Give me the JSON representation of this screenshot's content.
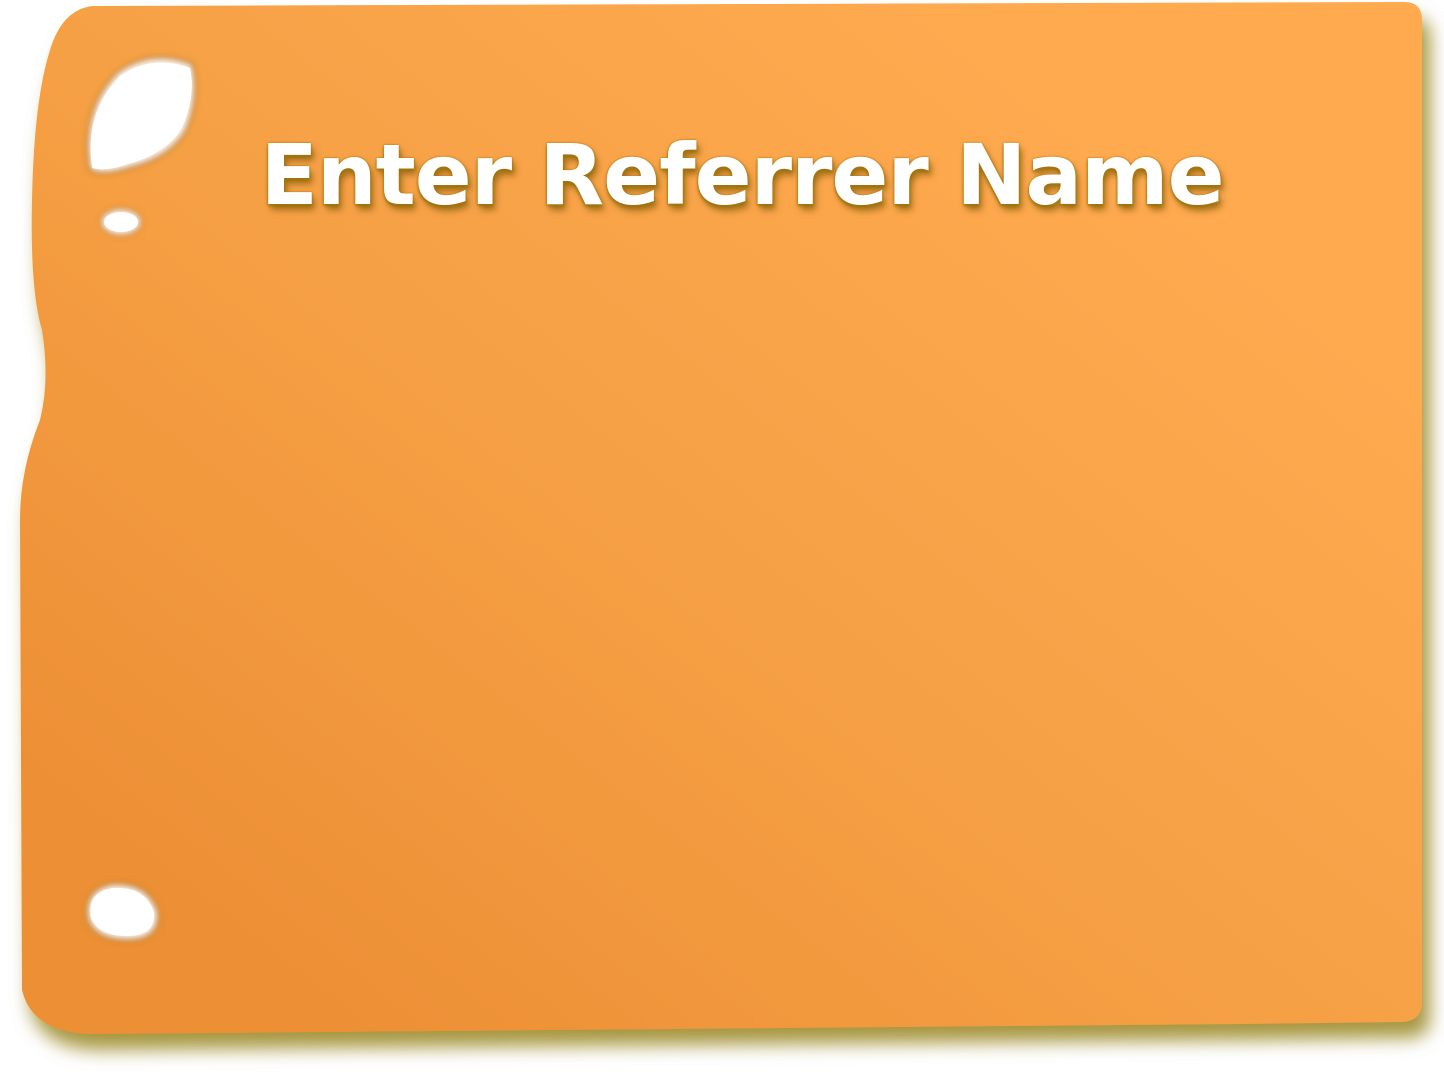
{
  "dialog": {
    "title": "Enter Referrer Name",
    "colors": {
      "panel_light": "#ffa84e",
      "panel_dark": "#ee8f33",
      "shadow": "#8a7400",
      "title_text": "#ffffff"
    },
    "icons": [
      "bracket-hole-icon",
      "rivet-hole-icon"
    ]
  }
}
